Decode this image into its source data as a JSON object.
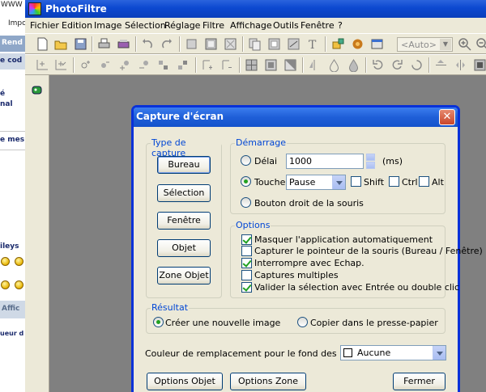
{
  "background_page": {
    "texts": [
      "WWW",
      "Impo",
      "Rend",
      "e cod",
      "é",
      "nal",
      "e mes",
      "ileys",
      "Affic",
      "ueur d"
    ]
  },
  "app": {
    "title": "PhotoFiltre",
    "menu": [
      "Fichier",
      "Edition",
      "Image",
      "Sélection",
      "Réglage",
      "Filtre",
      "Affichage",
      "Outils",
      "Fenêtre",
      "?"
    ],
    "zoom_value": "<Auto>"
  },
  "dialog": {
    "title": "Capture d'écran",
    "close": "✕",
    "type_group": {
      "legend": "Type de capture",
      "buttons": [
        "Bureau",
        "Sélection",
        "Fenêtre",
        "Objet",
        "Zone Objet"
      ]
    },
    "start_group": {
      "legend": "Démarrage",
      "delay_label": "Délai",
      "delay_value": "1000",
      "delay_unit": "(ms)",
      "key_label": "Touche",
      "key_value": "Pause",
      "modifiers": [
        "Shift",
        "Ctrl",
        "Alt"
      ],
      "mouse_label": "Bouton droit de la souris",
      "selected": "Touche"
    },
    "options_group": {
      "legend": "Options",
      "items": [
        {
          "label": "Masquer l'application automatiquement",
          "checked": true
        },
        {
          "label": "Capturer le pointeur de la souris (Bureau / Fenêtre)",
          "checked": false
        },
        {
          "label": "Interrompre avec Echap.",
          "checked": true
        },
        {
          "label": "Captures multiples",
          "checked": false
        },
        {
          "label": "Valider la sélection avec Entrée ou double clic",
          "checked": true
        }
      ]
    },
    "result_group": {
      "legend": "Résultat",
      "new_image": "Créer une nouvelle image",
      "clipboard": "Copier dans le presse-papier",
      "selected": "Créer une nouvelle image"
    },
    "listview": {
      "label": "Couleur de remplacement pour le fond des 'ListView' :",
      "value": "Aucune"
    },
    "footer_buttons": [
      "Options Objet",
      "Options Zone Objet",
      "Fermer"
    ]
  }
}
